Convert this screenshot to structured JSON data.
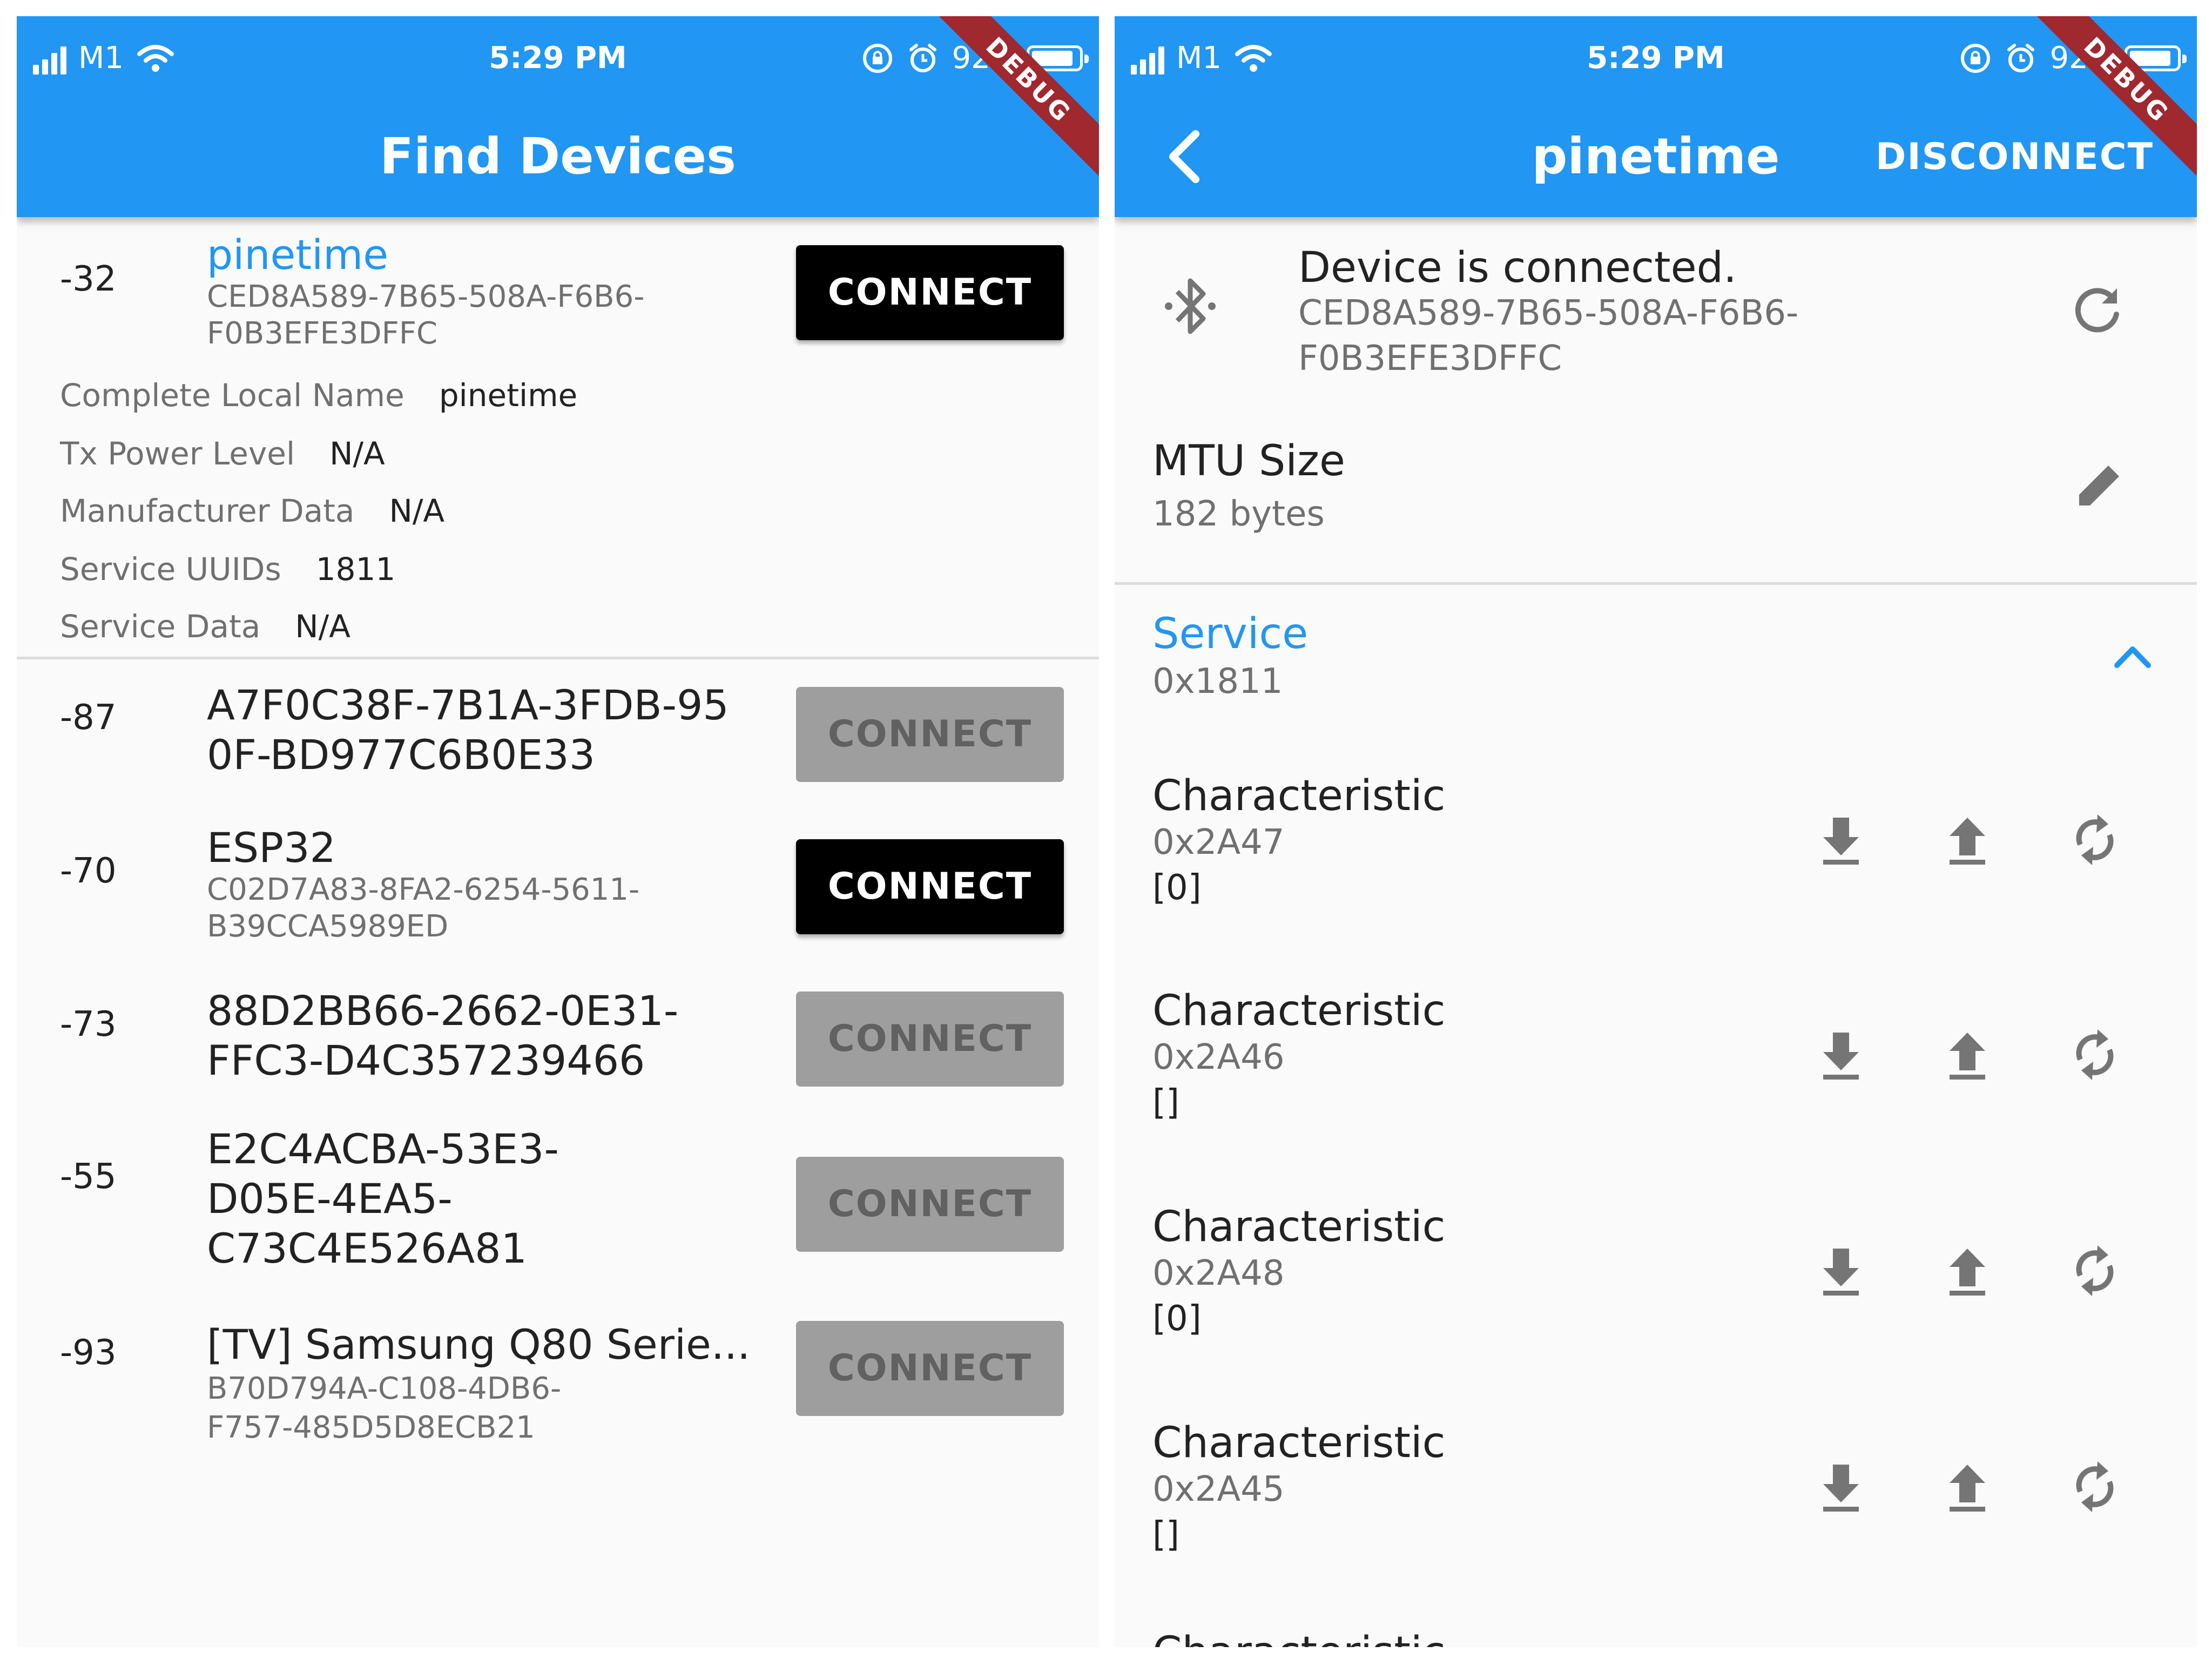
{
  "status_bar": {
    "carrier": "M1",
    "time": "5:29 PM",
    "battery": "92%",
    "debug": "DEBUG"
  },
  "colors": {
    "primary": "#2196f3",
    "debug_banner": "#a0282f",
    "button_enabled": "#000000",
    "button_disabled": "#9e9e9e"
  },
  "find_devices": {
    "title": "Find Devices",
    "devices": [
      {
        "rssi": "-32",
        "name": "pinetime",
        "id": "CED8A589-7B65-508A-F6B6-F0B3EFE3DFFC",
        "id_line1": "CED8A589-7B65-508A-F6B6-",
        "id_line2": "F0B3EFE3DFFC",
        "button": "CONNECT",
        "enabled": true,
        "expanded": true,
        "advertisement": [
          {
            "label": "Complete Local Name",
            "value": "pinetime"
          },
          {
            "label": "Tx Power Level",
            "value": "N/A"
          },
          {
            "label": "Manufacturer Data",
            "value": "N/A"
          },
          {
            "label": "Service UUIDs",
            "value": "1811"
          },
          {
            "label": "Service Data",
            "value": "N/A"
          }
        ]
      },
      {
        "rssi": "-87",
        "name_line1": "A7F0C38F-7B1A-3FDB-95",
        "name_line2": "0F-BD977C6B0E33",
        "button": "CONNECT",
        "enabled": false
      },
      {
        "rssi": "-70",
        "name": "ESP32",
        "id_line1": "C02D7A83-8FA2-6254-5611-",
        "id_line2": "B39CCA5989ED",
        "button": "CONNECT",
        "enabled": true
      },
      {
        "rssi": "-73",
        "name_line1": "88D2BB66-2662-0E31-",
        "name_line2": "FFC3-D4C357239466",
        "button": "CONNECT",
        "enabled": false
      },
      {
        "rssi": "-55",
        "name_line1": "E2C4ACBA-53E3-",
        "name_line2": "D05E-4EA5-",
        "name_line3": "C73C4E526A81",
        "button": "CONNECT",
        "enabled": false
      },
      {
        "rssi": "-93",
        "name": "[TV] Samsung Q80 Serie...",
        "id_line1": "B70D794A-C108-4DB6-",
        "id_line2": "F757-485D5D8ECB21",
        "button": "CONNECT",
        "enabled": false
      }
    ]
  },
  "device_page": {
    "title": "pinetime",
    "action": "DISCONNECT",
    "connection": {
      "status": "Device is connected.",
      "id_line1": "CED8A589-7B65-508A-F6B6-",
      "id_line2": "F0B3EFE3DFFC"
    },
    "mtu": {
      "label": "MTU Size",
      "value": "182 bytes"
    },
    "service": {
      "label": "Service",
      "uuid": "0x1811"
    },
    "characteristics": [
      {
        "label": "Characteristic",
        "uuid": "0x2A47",
        "value": "[0]"
      },
      {
        "label": "Characteristic",
        "uuid": "0x2A46",
        "value": "[]"
      },
      {
        "label": "Characteristic",
        "uuid": "0x2A48",
        "value": "[0]"
      },
      {
        "label": "Characteristic",
        "uuid": "0x2A45",
        "value": "[]"
      },
      {
        "label": "Characteristic"
      }
    ],
    "icons": [
      "bluetooth-icon",
      "refresh-icon",
      "edit-icon",
      "chevron-up-icon",
      "download-icon",
      "upload-icon",
      "sync-icon"
    ]
  }
}
